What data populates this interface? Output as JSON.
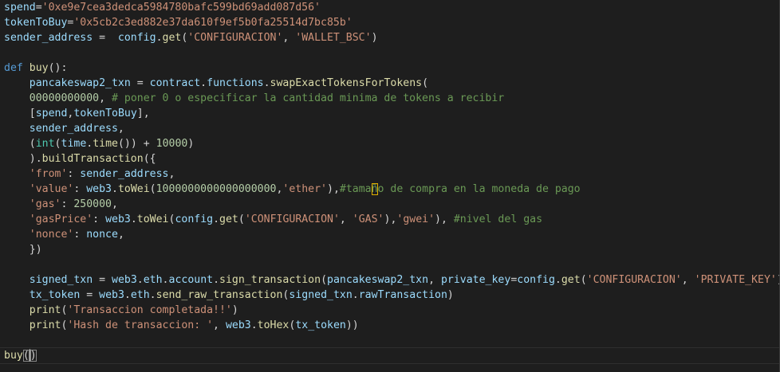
{
  "editor": {
    "lines": [
      [
        {
          "t": "spend",
          "c": "var"
        },
        {
          "t": "=",
          "c": "op"
        },
        {
          "t": "'0xe9e7cea3dedca5984780bafc599bd69add087d56'",
          "c": "str"
        }
      ],
      [
        {
          "t": "tokenToBuy",
          "c": "var"
        },
        {
          "t": "=",
          "c": "op"
        },
        {
          "t": "'0x5cb2c3ed882e37da610f9ef5b0fa25514d7bc85b'",
          "c": "str"
        }
      ],
      [
        {
          "t": "sender_address",
          "c": "var"
        },
        {
          "t": " =  ",
          "c": "op"
        },
        {
          "t": "config",
          "c": "var"
        },
        {
          "t": ".",
          "c": "op"
        },
        {
          "t": "get",
          "c": "fn"
        },
        {
          "t": "(",
          "c": "op"
        },
        {
          "t": "'CONFIGURACION'",
          "c": "str"
        },
        {
          "t": ", ",
          "c": "op"
        },
        {
          "t": "'WALLET_BSC'",
          "c": "str"
        },
        {
          "t": ")",
          "c": "op"
        }
      ],
      [],
      [
        {
          "t": "def",
          "c": "kw"
        },
        {
          "t": " ",
          "c": "op"
        },
        {
          "t": "buy",
          "c": "fn"
        },
        {
          "t": "():",
          "c": "op"
        }
      ],
      [
        {
          "t": "    ",
          "c": "op"
        },
        {
          "t": "pancakeswap2_txn",
          "c": "var"
        },
        {
          "t": " = ",
          "c": "op"
        },
        {
          "t": "contract",
          "c": "var"
        },
        {
          "t": ".",
          "c": "op"
        },
        {
          "t": "functions",
          "c": "var"
        },
        {
          "t": ".",
          "c": "op"
        },
        {
          "t": "swapExactTokensForTokens",
          "c": "fn"
        },
        {
          "t": "(",
          "c": "op"
        }
      ],
      [
        {
          "t": "    ",
          "c": "op"
        },
        {
          "t": "00000000000",
          "c": "num"
        },
        {
          "t": ", ",
          "c": "op"
        },
        {
          "t": "# poner 0 o especificar la cantidad minima de tokens a recibir",
          "c": "cmt"
        }
      ],
      [
        {
          "t": "    ",
          "c": "op"
        },
        {
          "t": "[",
          "c": "op"
        },
        {
          "t": "spend",
          "c": "var"
        },
        {
          "t": ",",
          "c": "op"
        },
        {
          "t": "tokenToBuy",
          "c": "var"
        },
        {
          "t": "],",
          "c": "op"
        }
      ],
      [
        {
          "t": "    ",
          "c": "op"
        },
        {
          "t": "sender_address",
          "c": "var"
        },
        {
          "t": ",",
          "c": "op"
        }
      ],
      [
        {
          "t": "    ",
          "c": "op"
        },
        {
          "t": "(",
          "c": "op"
        },
        {
          "t": "int",
          "c": "bi"
        },
        {
          "t": "(",
          "c": "op"
        },
        {
          "t": "time",
          "c": "var"
        },
        {
          "t": ".",
          "c": "op"
        },
        {
          "t": "time",
          "c": "fn"
        },
        {
          "t": "()) + ",
          "c": "op"
        },
        {
          "t": "10000",
          "c": "num"
        },
        {
          "t": ")",
          "c": "op"
        }
      ],
      [
        {
          "t": "    ",
          "c": "op"
        },
        {
          "t": ").",
          "c": "op"
        },
        {
          "t": "buildTransaction",
          "c": "fn"
        },
        {
          "t": "({",
          "c": "op"
        }
      ],
      [
        {
          "t": "    ",
          "c": "op"
        },
        {
          "t": "'from'",
          "c": "str"
        },
        {
          "t": ": ",
          "c": "op"
        },
        {
          "t": "sender_address",
          "c": "var"
        },
        {
          "t": ",",
          "c": "op"
        }
      ],
      [
        {
          "t": "    ",
          "c": "op"
        },
        {
          "t": "'value'",
          "c": "str"
        },
        {
          "t": ": ",
          "c": "op"
        },
        {
          "t": "web3",
          "c": "var"
        },
        {
          "t": ".",
          "c": "op"
        },
        {
          "t": "toWei",
          "c": "fn"
        },
        {
          "t": "(",
          "c": "op"
        },
        {
          "t": "1000000000000000000",
          "c": "num"
        },
        {
          "t": ",",
          "c": "op"
        },
        {
          "t": "'ether'",
          "c": "str"
        },
        {
          "t": "),",
          "c": "op"
        },
        {
          "t": "#tama",
          "c": "cmt"
        },
        {
          "t": "ñ",
          "c": "cmt",
          "cursor": true
        },
        {
          "t": "o de compra en la moneda de pago",
          "c": "cmt"
        }
      ],
      [
        {
          "t": "    ",
          "c": "op"
        },
        {
          "t": "'gas'",
          "c": "str"
        },
        {
          "t": ": ",
          "c": "op"
        },
        {
          "t": "250000",
          "c": "num"
        },
        {
          "t": ",",
          "c": "op"
        }
      ],
      [
        {
          "t": "    ",
          "c": "op"
        },
        {
          "t": "'gasPrice'",
          "c": "str"
        },
        {
          "t": ": ",
          "c": "op"
        },
        {
          "t": "web3",
          "c": "var"
        },
        {
          "t": ".",
          "c": "op"
        },
        {
          "t": "toWei",
          "c": "fn"
        },
        {
          "t": "(",
          "c": "op"
        },
        {
          "t": "config",
          "c": "var"
        },
        {
          "t": ".",
          "c": "op"
        },
        {
          "t": "get",
          "c": "fn"
        },
        {
          "t": "(",
          "c": "op"
        },
        {
          "t": "'CONFIGURACION'",
          "c": "str"
        },
        {
          "t": ", ",
          "c": "op"
        },
        {
          "t": "'GAS'",
          "c": "str"
        },
        {
          "t": "),",
          "c": "op"
        },
        {
          "t": "'gwei'",
          "c": "str"
        },
        {
          "t": "), ",
          "c": "op"
        },
        {
          "t": "#nivel del gas",
          "c": "cmt"
        }
      ],
      [
        {
          "t": "    ",
          "c": "op"
        },
        {
          "t": "'nonce'",
          "c": "str"
        },
        {
          "t": ": ",
          "c": "op"
        },
        {
          "t": "nonce",
          "c": "var"
        },
        {
          "t": ",",
          "c": "op"
        }
      ],
      [
        {
          "t": "    ",
          "c": "op"
        },
        {
          "t": "})",
          "c": "op"
        }
      ],
      [],
      [
        {
          "t": "    ",
          "c": "op"
        },
        {
          "t": "signed_txn",
          "c": "var"
        },
        {
          "t": " = ",
          "c": "op"
        },
        {
          "t": "web3",
          "c": "var"
        },
        {
          "t": ".",
          "c": "op"
        },
        {
          "t": "eth",
          "c": "var"
        },
        {
          "t": ".",
          "c": "op"
        },
        {
          "t": "account",
          "c": "var"
        },
        {
          "t": ".",
          "c": "op"
        },
        {
          "t": "sign_transaction",
          "c": "fn"
        },
        {
          "t": "(",
          "c": "op"
        },
        {
          "t": "pancakeswap2_txn",
          "c": "var"
        },
        {
          "t": ", ",
          "c": "op"
        },
        {
          "t": "private_key",
          "c": "var"
        },
        {
          "t": "=",
          "c": "op"
        },
        {
          "t": "config",
          "c": "var"
        },
        {
          "t": ".",
          "c": "op"
        },
        {
          "t": "get",
          "c": "fn"
        },
        {
          "t": "(",
          "c": "op"
        },
        {
          "t": "'CONFIGURACION'",
          "c": "str"
        },
        {
          "t": ", ",
          "c": "op"
        },
        {
          "t": "'PRIVATE_KEY'",
          "c": "str"
        },
        {
          "t": "))",
          "c": "op"
        }
      ],
      [
        {
          "t": "    ",
          "c": "op"
        },
        {
          "t": "tx_token",
          "c": "var"
        },
        {
          "t": " = ",
          "c": "op"
        },
        {
          "t": "web3",
          "c": "var"
        },
        {
          "t": ".",
          "c": "op"
        },
        {
          "t": "eth",
          "c": "var"
        },
        {
          "t": ".",
          "c": "op"
        },
        {
          "t": "send_raw_transaction",
          "c": "fn"
        },
        {
          "t": "(",
          "c": "op"
        },
        {
          "t": "signed_txn",
          "c": "var"
        },
        {
          "t": ".",
          "c": "op"
        },
        {
          "t": "rawTransaction",
          "c": "var"
        },
        {
          "t": ")",
          "c": "op"
        }
      ],
      [
        {
          "t": "    ",
          "c": "op"
        },
        {
          "t": "print",
          "c": "fn"
        },
        {
          "t": "(",
          "c": "op"
        },
        {
          "t": "'Transaccion completada!!'",
          "c": "str"
        },
        {
          "t": ")",
          "c": "op"
        }
      ],
      [
        {
          "t": "    ",
          "c": "op"
        },
        {
          "t": "print",
          "c": "fn"
        },
        {
          "t": "(",
          "c": "op"
        },
        {
          "t": "'Hash de transaccion: '",
          "c": "str"
        },
        {
          "t": ", ",
          "c": "op"
        },
        {
          "t": "web3",
          "c": "var"
        },
        {
          "t": ".",
          "c": "op"
        },
        {
          "t": "toHex",
          "c": "fn"
        },
        {
          "t": "(",
          "c": "op"
        },
        {
          "t": "tx_token",
          "c": "var"
        },
        {
          "t": "))",
          "c": "op"
        }
      ]
    ],
    "current_line": [
      {
        "t": "buy",
        "c": "fn"
      },
      {
        "t": "(",
        "c": "op",
        "match": true
      },
      {
        "t": ")",
        "c": "op",
        "match": true
      }
    ]
  },
  "colors": {
    "background": "#1e1e1e",
    "keyword": "#569cd6",
    "function": "#dcdcaa",
    "variable": "#9cdcfe",
    "string": "#ce9178",
    "number": "#b5cea8",
    "comment": "#6a9955",
    "builtin": "#4ec9b0"
  }
}
